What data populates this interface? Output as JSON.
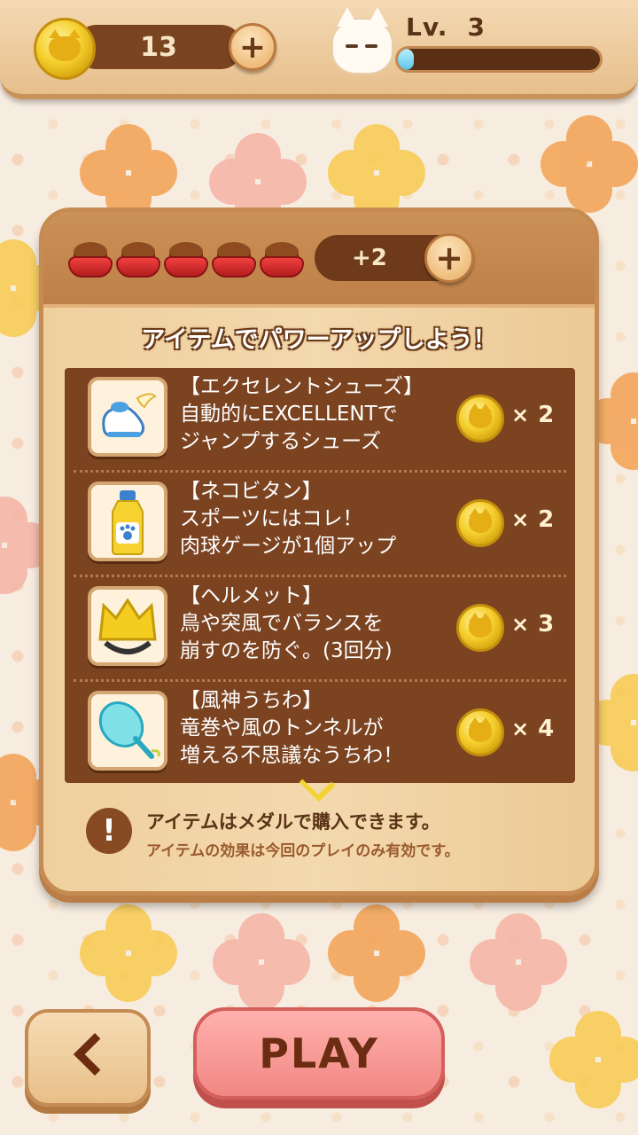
{
  "header": {
    "coin_count": "13",
    "level_label": "Lv.",
    "level_value": "3",
    "xp_progress": 0.08
  },
  "panel": {
    "food_bowls": 5,
    "bonus_label": "+2",
    "title": "アイテムでパワーアップしよう！",
    "items": [
      {
        "name": "【エクセレントシューズ】",
        "line1": "自動的にEXCELLENTで",
        "line2": "ジャンプするシューズ",
        "price": "2",
        "icon": "winged-shoe-icon"
      },
      {
        "name": "【ネコビタン】",
        "line1": "スポーツにはコレ！",
        "line2": "肉球ゲージが1個アップ",
        "price": "2",
        "icon": "vitamin-bottle-icon"
      },
      {
        "name": "【ヘルメット】",
        "line1": "鳥や突風でバランスを",
        "line2": "崩すのを防ぐ。(3回分)",
        "price": "3",
        "icon": "cat-helmet-icon"
      },
      {
        "name": "【風神うちわ】",
        "line1": "竜巻や風のトンネルが",
        "line2": "増える不思議なうちわ！",
        "price": "4",
        "icon": "wind-fan-icon"
      }
    ],
    "price_prefix": "×",
    "notice_primary": "アイテムはメダルで購入できます。",
    "notice_secondary": "アイテムの効果は今回のプレイのみ有効です。"
  },
  "buttons": {
    "play_label": "PLAY"
  },
  "colors": {
    "wood": "#e7bf8c",
    "list_bg": "#7c4321",
    "play": "#f18783",
    "xp": "#5cc4e8"
  }
}
